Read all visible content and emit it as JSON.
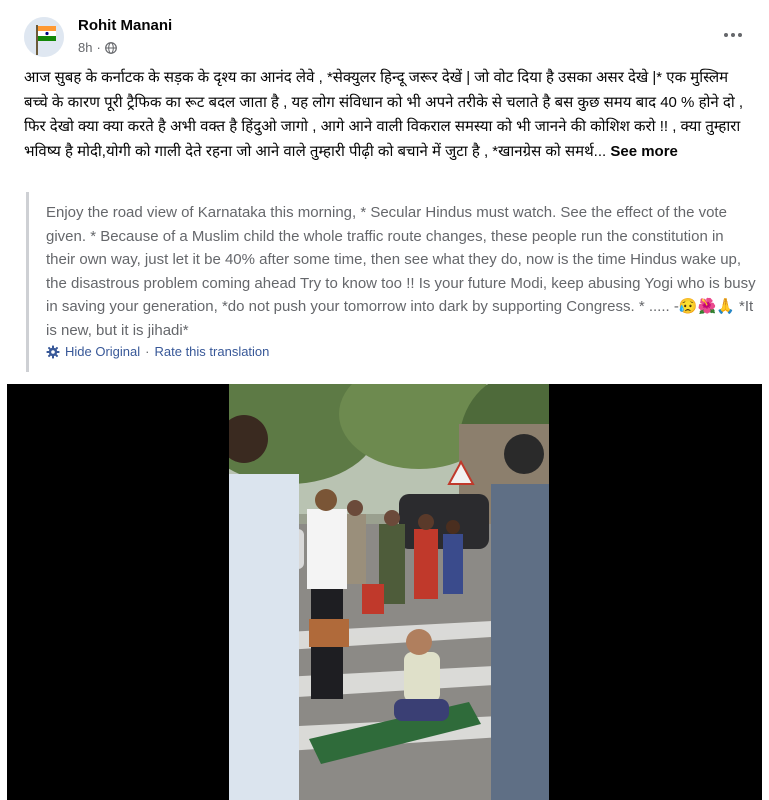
{
  "post": {
    "author": "Rohit Manani",
    "time": "8h",
    "privacy_icon": "globe-icon",
    "menu_icon": "more-horizontal-icon",
    "original_text": "आज सुबह के कर्नाटक के सड़क के दृश्य का आनंद लेवे , *सेक्युलर हिन्दू जरूर देखें | जो वोट दिया है उसका असर देखे |* एक मुस्लिम  बच्चे के कारण पूरी ट्रैफिक का रूट बदल जाता है , यह लोग संविधान को भी अपने तरीके से चलाते है बस कुछ समय बाद 40 % होने दो ,  फिर देखो क्या क्या करते है अभी वक्त है हिंदुओ जागो , आगे आने वाली विकराल समस्या को भी जानने की कोशिश करो !! ,  क्या तुम्हारा भविष्य है मोदी,योगी को गाली देते रहना जो आने वाले तुम्हारी पीढ़ी को बचाने में जुटा है ,  *खानग्रेस को  समर्थ...",
    "see_more": "See more",
    "translation_text": "Enjoy the road view of Karnataka this morning, * Secular Hindus must watch. See the effect of the vote given. * Because of a Muslim child the whole traffic route changes, these people run the constitution in their own way, just let it be 40% after some time, then see what they do, now is the time Hindus wake up, the disastrous problem coming ahead Try to know too !! Is your future Modi, keep abusing Yogi who is busy in saving your generation, *do not push your tomorrow into dark by supporting Congress. * ..... -",
    "translation_emoji": "😥🌺🙏",
    "translation_tail": " *It is new, but it is jihadi*",
    "hide_original": "Hide Original",
    "separator": "·",
    "rate_translation": "Rate this translation"
  },
  "colors": {
    "link": "#385898",
    "secondary_text": "#65676b",
    "quote_border": "#ced0d4"
  }
}
